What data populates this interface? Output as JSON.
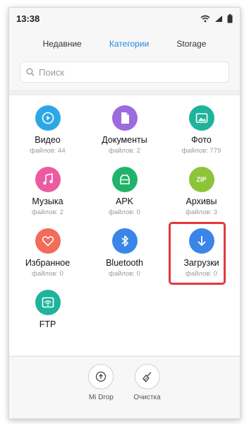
{
  "status": {
    "time": "13:38"
  },
  "tabs": [
    {
      "label": "Недавние"
    },
    {
      "label": "Категории",
      "active": true
    },
    {
      "label": "Storage"
    }
  ],
  "search": {
    "placeholder": "Поиск"
  },
  "categories": [
    {
      "name": "Видео",
      "count": "файлов: 44",
      "color": "#2fa7e6",
      "icon": "play-icon"
    },
    {
      "name": "Документы",
      "count": "файлов: 2",
      "color": "#9c6bdc",
      "icon": "document-icon"
    },
    {
      "name": "Фото",
      "count": "файлов: 779",
      "color": "#1fb39c",
      "icon": "photo-icon"
    },
    {
      "name": "Музыка",
      "count": "файлов: 2",
      "color": "#ec5ba0",
      "icon": "music-icon"
    },
    {
      "name": "APK",
      "count": "файлов: 0",
      "color": "#20b36a",
      "icon": "android-icon"
    },
    {
      "name": "Архивы",
      "count": "файлов: 3",
      "color": "#8cc43a",
      "icon": "zip-icon",
      "badge": "ZIP"
    },
    {
      "name": "Избранное",
      "count": "файлов: 0",
      "color": "#f26b5b",
      "icon": "heart-icon"
    },
    {
      "name": "Bluetooth",
      "count": "файлов: 0",
      "color": "#3a86e8",
      "icon": "bluetooth-icon"
    },
    {
      "name": "Загрузки",
      "count": "файлов: 0",
      "color": "#3a86e8",
      "icon": "download-icon"
    },
    {
      "name": "FTP",
      "count": "",
      "color": "#1fb39c",
      "icon": "ftp-icon"
    }
  ],
  "bottom": [
    {
      "label": "Mi Drop",
      "icon": "mi-drop-icon"
    },
    {
      "label": "Очистка",
      "icon": "broom-icon"
    }
  ]
}
